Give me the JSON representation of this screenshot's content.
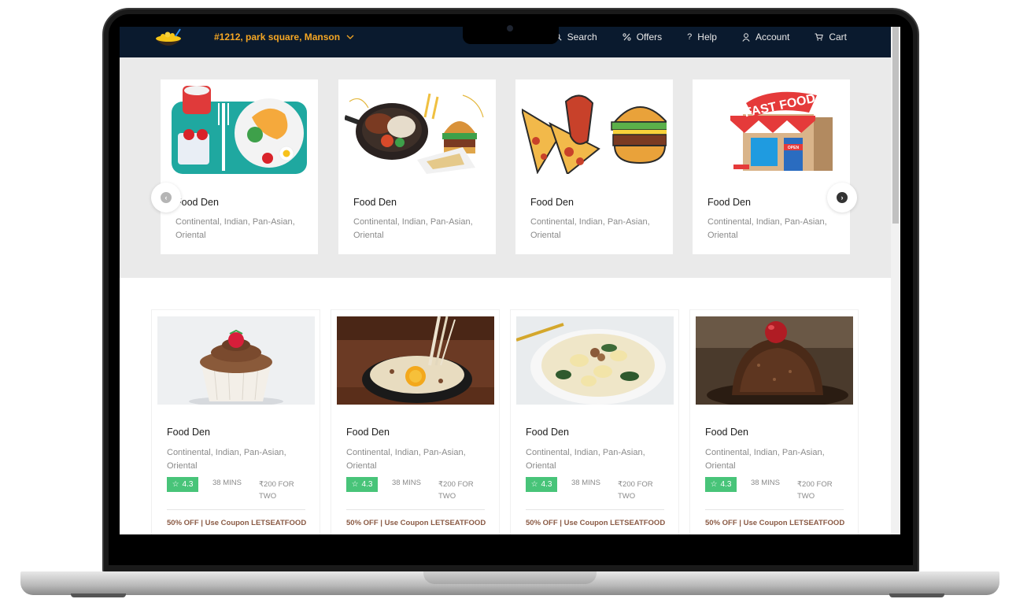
{
  "header": {
    "address": "#1212, park square, Manson",
    "nav": [
      {
        "label": "Search",
        "icon": "search-icon"
      },
      {
        "label": "Offers",
        "icon": "percent-icon"
      },
      {
        "label": "Help",
        "icon": "help-icon"
      },
      {
        "label": "Account",
        "icon": "user-icon"
      },
      {
        "label": "Cart",
        "icon": "cart-icon"
      }
    ]
  },
  "carousel": {
    "cards": [
      {
        "title": "Food Den",
        "cuisines": "Continental, Indian, Pan-Asian, Oriental"
      },
      {
        "title": "Food Den",
        "cuisines": "Continental, Indian, Pan-Asian, Oriental"
      },
      {
        "title": "Food Den",
        "cuisines": "Continental, Indian, Pan-Asian, Oriental"
      },
      {
        "title": "Food Den",
        "cuisines": "Continental, Indian, Pan-Asian, Oriental"
      }
    ],
    "fast_food_sign": "FAST FOOD",
    "open_sign": "OPEN"
  },
  "restaurants": [
    {
      "title": "Food Den",
      "cuisines": "Continental, Indian, Pan-Asian, Oriental",
      "rating": "4.3",
      "time": "38 MINS",
      "price": "₹200 FOR TWO",
      "offer": "50% OFF | Use Coupon LETSEATFOOD"
    },
    {
      "title": "Food Den",
      "cuisines": "Continental, Indian, Pan-Asian, Oriental",
      "rating": "4.3",
      "time": "38 MINS",
      "price": "₹200 FOR TWO",
      "offer": "50% OFF | Use Coupon LETSEATFOOD"
    },
    {
      "title": "Food Den",
      "cuisines": "Continental, Indian, Pan-Asian, Oriental",
      "rating": "4.3",
      "time": "38 MINS",
      "price": "₹200 FOR TWO",
      "offer": "50% OFF | Use Coupon LETSEATFOOD"
    },
    {
      "title": "Food Den",
      "cuisines": "Continental, Indian, Pan-Asian, Oriental",
      "rating": "4.3",
      "time": "38 MINS",
      "price": "₹200 FOR TWO",
      "offer": "50% OFF | Use Coupon LETSEATFOOD"
    }
  ],
  "colors": {
    "navbar": "#0a1a2e",
    "address": "#f5a623",
    "rating_badge": "#48c479",
    "offer_text": "#8a5a44",
    "carousel_bg": "#eaeaea"
  }
}
